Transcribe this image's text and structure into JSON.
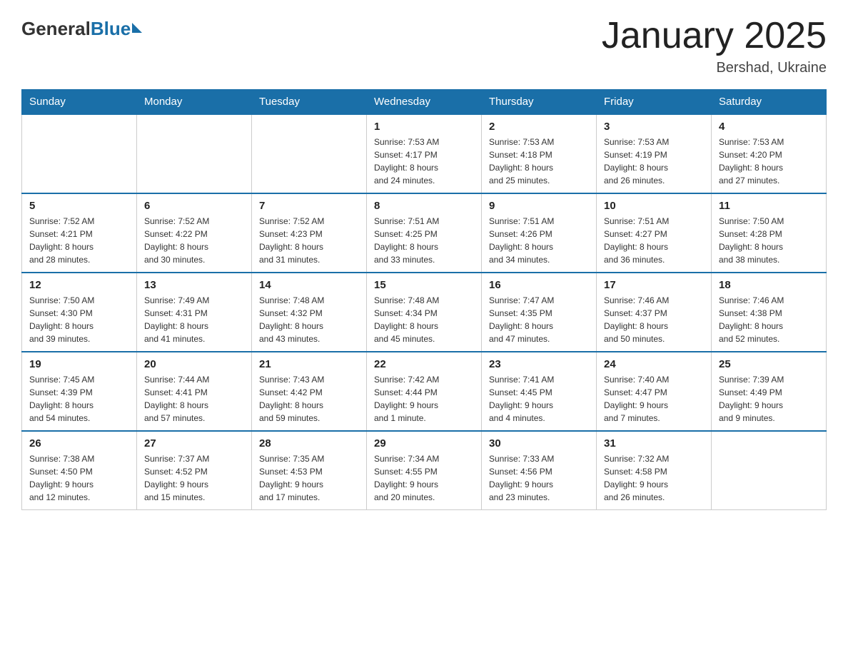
{
  "logo": {
    "general": "General",
    "blue": "Blue"
  },
  "title": "January 2025",
  "subtitle": "Bershad, Ukraine",
  "days_of_week": [
    "Sunday",
    "Monday",
    "Tuesday",
    "Wednesday",
    "Thursday",
    "Friday",
    "Saturday"
  ],
  "weeks": [
    [
      {
        "day": "",
        "info": ""
      },
      {
        "day": "",
        "info": ""
      },
      {
        "day": "",
        "info": ""
      },
      {
        "day": "1",
        "info": "Sunrise: 7:53 AM\nSunset: 4:17 PM\nDaylight: 8 hours\nand 24 minutes."
      },
      {
        "day": "2",
        "info": "Sunrise: 7:53 AM\nSunset: 4:18 PM\nDaylight: 8 hours\nand 25 minutes."
      },
      {
        "day": "3",
        "info": "Sunrise: 7:53 AM\nSunset: 4:19 PM\nDaylight: 8 hours\nand 26 minutes."
      },
      {
        "day": "4",
        "info": "Sunrise: 7:53 AM\nSunset: 4:20 PM\nDaylight: 8 hours\nand 27 minutes."
      }
    ],
    [
      {
        "day": "5",
        "info": "Sunrise: 7:52 AM\nSunset: 4:21 PM\nDaylight: 8 hours\nand 28 minutes."
      },
      {
        "day": "6",
        "info": "Sunrise: 7:52 AM\nSunset: 4:22 PM\nDaylight: 8 hours\nand 30 minutes."
      },
      {
        "day": "7",
        "info": "Sunrise: 7:52 AM\nSunset: 4:23 PM\nDaylight: 8 hours\nand 31 minutes."
      },
      {
        "day": "8",
        "info": "Sunrise: 7:51 AM\nSunset: 4:25 PM\nDaylight: 8 hours\nand 33 minutes."
      },
      {
        "day": "9",
        "info": "Sunrise: 7:51 AM\nSunset: 4:26 PM\nDaylight: 8 hours\nand 34 minutes."
      },
      {
        "day": "10",
        "info": "Sunrise: 7:51 AM\nSunset: 4:27 PM\nDaylight: 8 hours\nand 36 minutes."
      },
      {
        "day": "11",
        "info": "Sunrise: 7:50 AM\nSunset: 4:28 PM\nDaylight: 8 hours\nand 38 minutes."
      }
    ],
    [
      {
        "day": "12",
        "info": "Sunrise: 7:50 AM\nSunset: 4:30 PM\nDaylight: 8 hours\nand 39 minutes."
      },
      {
        "day": "13",
        "info": "Sunrise: 7:49 AM\nSunset: 4:31 PM\nDaylight: 8 hours\nand 41 minutes."
      },
      {
        "day": "14",
        "info": "Sunrise: 7:48 AM\nSunset: 4:32 PM\nDaylight: 8 hours\nand 43 minutes."
      },
      {
        "day": "15",
        "info": "Sunrise: 7:48 AM\nSunset: 4:34 PM\nDaylight: 8 hours\nand 45 minutes."
      },
      {
        "day": "16",
        "info": "Sunrise: 7:47 AM\nSunset: 4:35 PM\nDaylight: 8 hours\nand 47 minutes."
      },
      {
        "day": "17",
        "info": "Sunrise: 7:46 AM\nSunset: 4:37 PM\nDaylight: 8 hours\nand 50 minutes."
      },
      {
        "day": "18",
        "info": "Sunrise: 7:46 AM\nSunset: 4:38 PM\nDaylight: 8 hours\nand 52 minutes."
      }
    ],
    [
      {
        "day": "19",
        "info": "Sunrise: 7:45 AM\nSunset: 4:39 PM\nDaylight: 8 hours\nand 54 minutes."
      },
      {
        "day": "20",
        "info": "Sunrise: 7:44 AM\nSunset: 4:41 PM\nDaylight: 8 hours\nand 57 minutes."
      },
      {
        "day": "21",
        "info": "Sunrise: 7:43 AM\nSunset: 4:42 PM\nDaylight: 8 hours\nand 59 minutes."
      },
      {
        "day": "22",
        "info": "Sunrise: 7:42 AM\nSunset: 4:44 PM\nDaylight: 9 hours\nand 1 minute."
      },
      {
        "day": "23",
        "info": "Sunrise: 7:41 AM\nSunset: 4:45 PM\nDaylight: 9 hours\nand 4 minutes."
      },
      {
        "day": "24",
        "info": "Sunrise: 7:40 AM\nSunset: 4:47 PM\nDaylight: 9 hours\nand 7 minutes."
      },
      {
        "day": "25",
        "info": "Sunrise: 7:39 AM\nSunset: 4:49 PM\nDaylight: 9 hours\nand 9 minutes."
      }
    ],
    [
      {
        "day": "26",
        "info": "Sunrise: 7:38 AM\nSunset: 4:50 PM\nDaylight: 9 hours\nand 12 minutes."
      },
      {
        "day": "27",
        "info": "Sunrise: 7:37 AM\nSunset: 4:52 PM\nDaylight: 9 hours\nand 15 minutes."
      },
      {
        "day": "28",
        "info": "Sunrise: 7:35 AM\nSunset: 4:53 PM\nDaylight: 9 hours\nand 17 minutes."
      },
      {
        "day": "29",
        "info": "Sunrise: 7:34 AM\nSunset: 4:55 PM\nDaylight: 9 hours\nand 20 minutes."
      },
      {
        "day": "30",
        "info": "Sunrise: 7:33 AM\nSunset: 4:56 PM\nDaylight: 9 hours\nand 23 minutes."
      },
      {
        "day": "31",
        "info": "Sunrise: 7:32 AM\nSunset: 4:58 PM\nDaylight: 9 hours\nand 26 minutes."
      },
      {
        "day": "",
        "info": ""
      }
    ]
  ]
}
